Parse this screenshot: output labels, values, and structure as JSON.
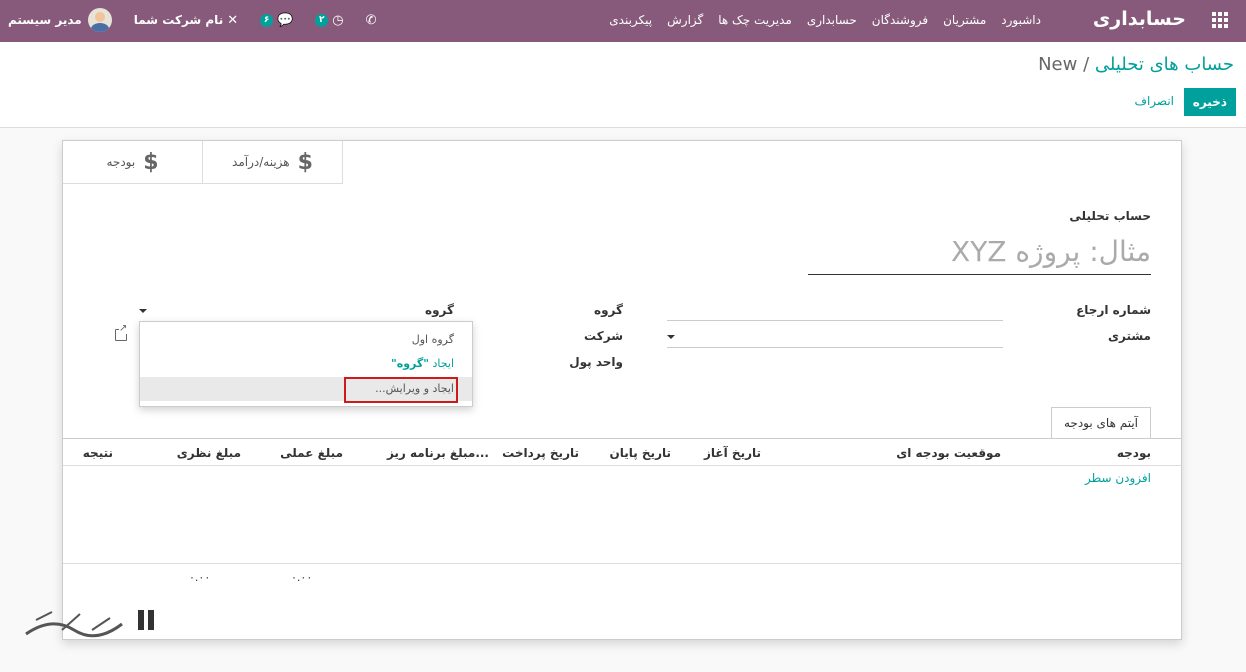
{
  "navbar": {
    "brand": "حسابداری",
    "menu": [
      "داشبورد",
      "مشتریان",
      "فروشندگان",
      "حسابداری",
      "مدیریت چک ها",
      "گزارش",
      "پیکربندی"
    ],
    "company": "نام شرکت شما",
    "user": "مدیر سیستم",
    "messages_count": "۶",
    "activities_count": "۲"
  },
  "breadcrumb": {
    "parent": "حساب های تحلیلی",
    "separator": "/",
    "current": "New"
  },
  "buttons": {
    "save": "ذخیره",
    "discard": "انصراف"
  },
  "smart_buttons": [
    {
      "label": "هزینه/درآمد",
      "icon": "dollar-icon"
    },
    {
      "label": "بودجه",
      "icon": "dollar-icon"
    }
  ],
  "form": {
    "title_label": "حساب تحلیلی",
    "title_placeholder": "مثال: پروژه XYZ",
    "reference_label": "شماره ارجاع",
    "customer_label": "مشتری",
    "group_label": "گروه",
    "group_value": "گروه",
    "company_label": "شرکت",
    "currency_label": "واحد پول"
  },
  "dropdown": {
    "option": "گروه اول",
    "create_prefix": "ایجاد",
    "create_value": "\"گروه\"",
    "create_edit": "ایجاد و ویرایش..."
  },
  "notebook": {
    "tab": "آیتم های بودجه",
    "columns": [
      "بودجه",
      "موقعیت بودجه ای",
      "تاریخ آغاز",
      "تاریخ پایان",
      "تاریخ پرداخت",
      "مبلغ برنامه ریز...",
      "مبلغ عملی",
      "مبلغ نظری",
      "نتیجه"
    ],
    "add_line": "افزودن سطر",
    "totals": {
      "practical": "۰.۰۰",
      "theoretical": "۰.۰۰"
    }
  },
  "watermark": "تسهیل گستر",
  "colors": {
    "primary": "#875a7b",
    "accent": "#00a09d",
    "highlight_box": "#d01a1a"
  }
}
